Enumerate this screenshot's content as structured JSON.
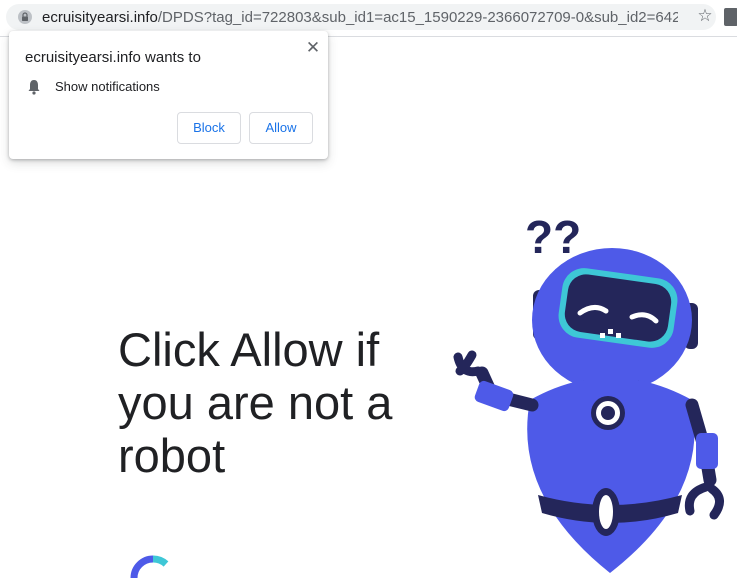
{
  "address_bar": {
    "url_host": "ecruisityearsi.info",
    "url_path": "/DPDS?tag_id=722803&sub_id1=ac15_1590229-2366072709-0&sub_id2=64259..."
  },
  "prompt": {
    "title": "ecruisityearsi.info wants to",
    "permission": "Show notifications",
    "block_label": "Block",
    "allow_label": "Allow",
    "close_glyph": "✕"
  },
  "main": {
    "headline": "Click Allow if you are not a robot",
    "illustration_marks": "??"
  },
  "colors": {
    "accent": "#1a73e8",
    "robot_body": "#4e5ae8",
    "robot_dark": "#24265a",
    "visor": "#3ec7d6"
  },
  "icons": [
    "lock-icon",
    "star-icon",
    "bell-icon",
    "close-icon",
    "spinner-icon"
  ]
}
